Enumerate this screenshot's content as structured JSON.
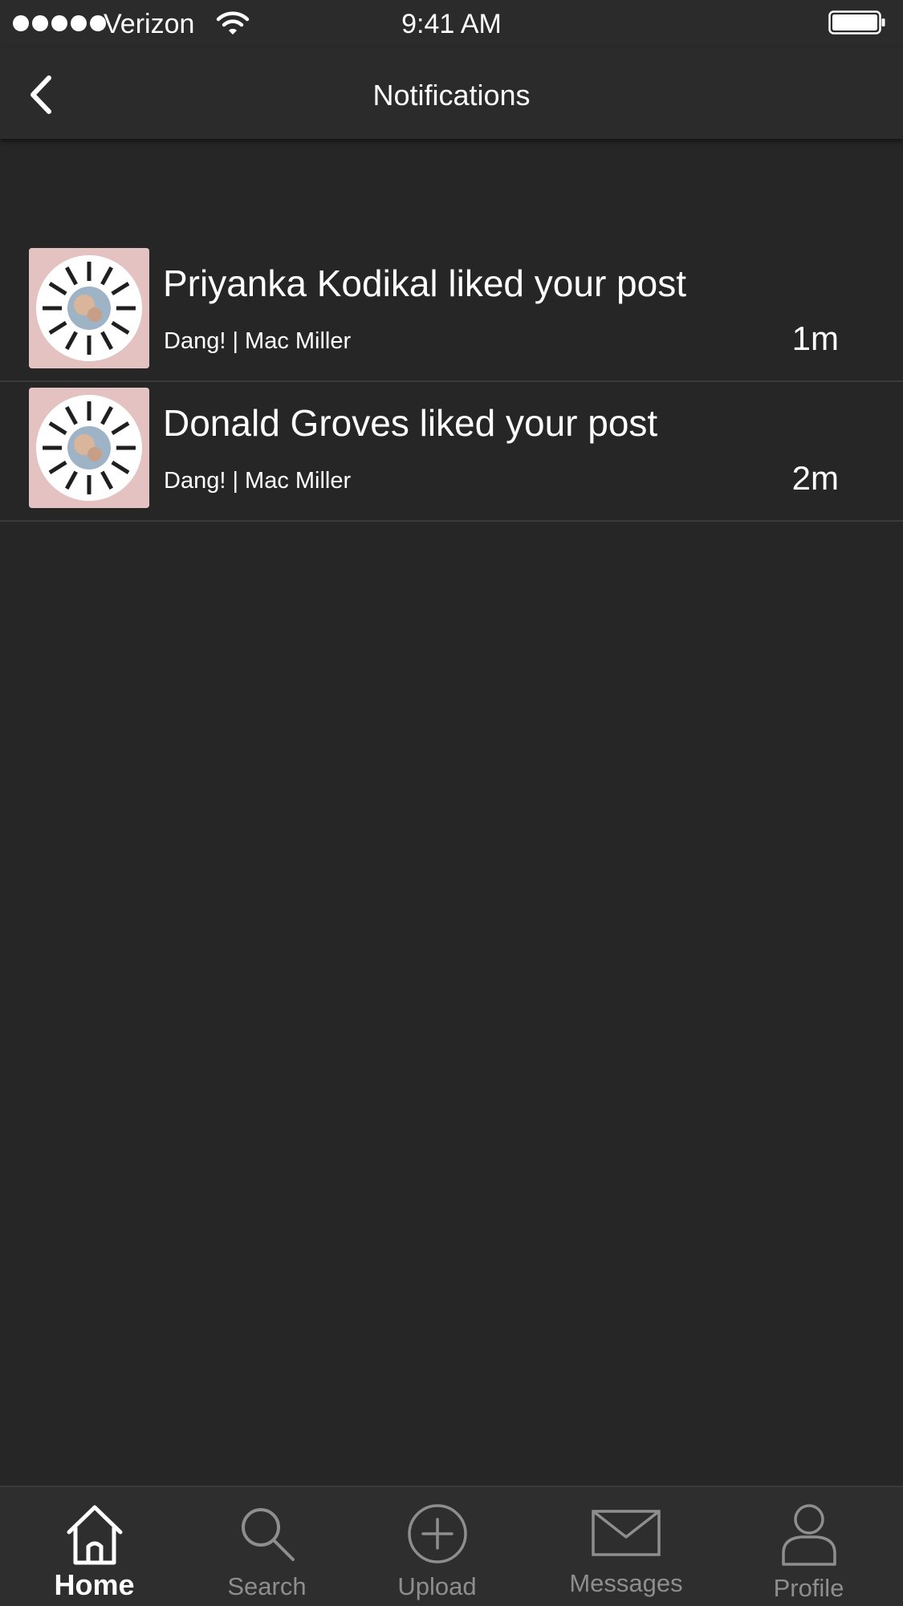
{
  "status_bar": {
    "carrier": "Verizon",
    "time": "9:41 AM"
  },
  "nav": {
    "title": "Notifications",
    "back_icon": "chevron-left-icon"
  },
  "notifications": [
    {
      "message": "Priyanka Kodikal liked your post",
      "post": "Dang! | Mac Miller",
      "time": "1m",
      "thumbnail": "album-art"
    },
    {
      "message": "Donald Groves liked your post",
      "post": "Dang! | Mac Miller",
      "time": "2m",
      "thumbnail": "album-art"
    }
  ],
  "tabs": [
    {
      "label": "Home",
      "icon": "home-icon",
      "active": true
    },
    {
      "label": "Search",
      "icon": "search-icon",
      "active": false
    },
    {
      "label": "Upload",
      "icon": "upload-plus-icon",
      "active": false
    },
    {
      "label": "Messages",
      "icon": "envelope-icon",
      "active": false
    },
    {
      "label": "Profile",
      "icon": "profile-icon",
      "active": false
    }
  ],
  "colors": {
    "background": "#262626",
    "bars": "#2b2b2b",
    "tab_bar": "#2e2e2e",
    "text": "#ffffff",
    "inactive_tab": "#8e8e8e",
    "divider": "#3a3a3a",
    "thumbnail_bg": "#e3c2c1"
  }
}
